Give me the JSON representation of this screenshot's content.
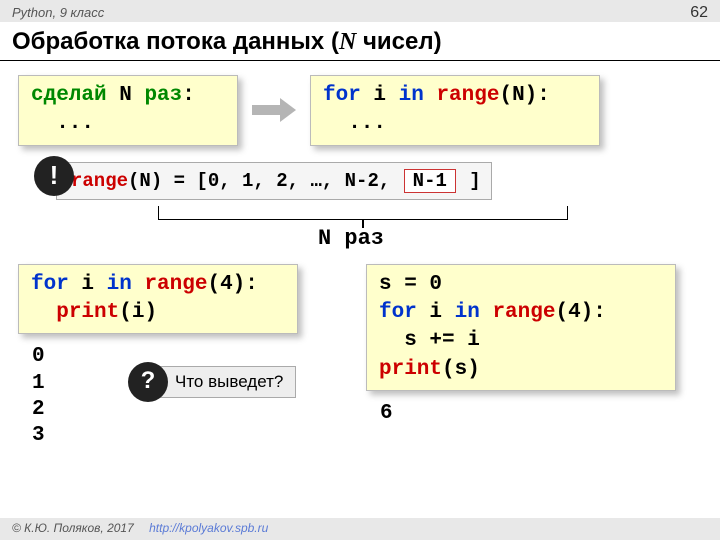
{
  "header": {
    "course": "Python, 9 класс",
    "page": "62"
  },
  "title": {
    "pre": "Обработка потока данных (",
    "ital": "N",
    "post": " чисел)"
  },
  "pseudo": {
    "line1_a": "сделай",
    "line1_b": " N ",
    "line1_c": "раз",
    "colon": ":",
    "line2": "  ..."
  },
  "loop": {
    "for": "for",
    "var": " i ",
    "in": "in",
    "sp": " ",
    "range": "range",
    "arg": "(N):",
    "body": "  ..."
  },
  "range_expl": {
    "range": "range",
    "eq": "(N) = [0, 1, 2, …, N-2, ",
    "boxed": "N-1",
    "close": " ]"
  },
  "excl_badge": "!",
  "ntimes": "N раз",
  "ex_left": {
    "for": "for",
    "var": " i ",
    "in": "in",
    "sp": " ",
    "range": "range",
    "arg": "(4):",
    "body_ind": "  ",
    "print": "print",
    "body_arg": "(i)"
  },
  "out_left": "0\n1\n2\n3",
  "ex_right": {
    "l1": "s = 0",
    "for": "for",
    "var": " i ",
    "in": "in",
    "sp": " ",
    "range": "range",
    "arg": "(4):",
    "body": "  s += i",
    "print": "print",
    "parg": "(s)"
  },
  "out_right": "6",
  "question": {
    "badge": "?",
    "text": "Что выведет?"
  },
  "footer": {
    "copy": "© К.Ю. Поляков, 2017",
    "link": "http://kpolyakov.spb.ru"
  }
}
